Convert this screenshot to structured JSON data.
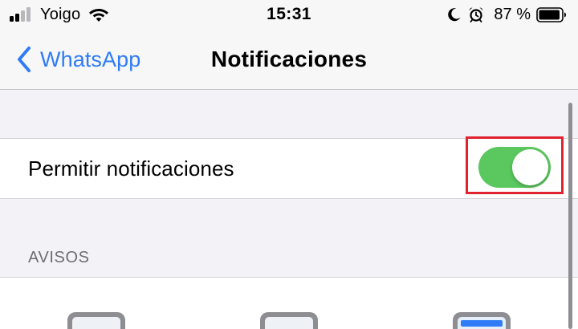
{
  "status_bar": {
    "carrier": "Yoigo",
    "time": "15:31",
    "battery_percent": "87 %",
    "icons": [
      "signal-icon",
      "wifi-icon",
      "moon-icon",
      "alarm-icon",
      "battery-icon"
    ]
  },
  "nav": {
    "back_label": "WhatsApp",
    "title": "Notificaciones"
  },
  "settings": {
    "allow_notifications": {
      "label": "Permitir notificaciones",
      "enabled": true
    }
  },
  "alerts": {
    "header": "AVISOS"
  },
  "colors": {
    "accent": "#2f7cf6",
    "toggle_on": "#5ac85e",
    "highlight": "#e0222f",
    "background": "#f2f2f7"
  }
}
